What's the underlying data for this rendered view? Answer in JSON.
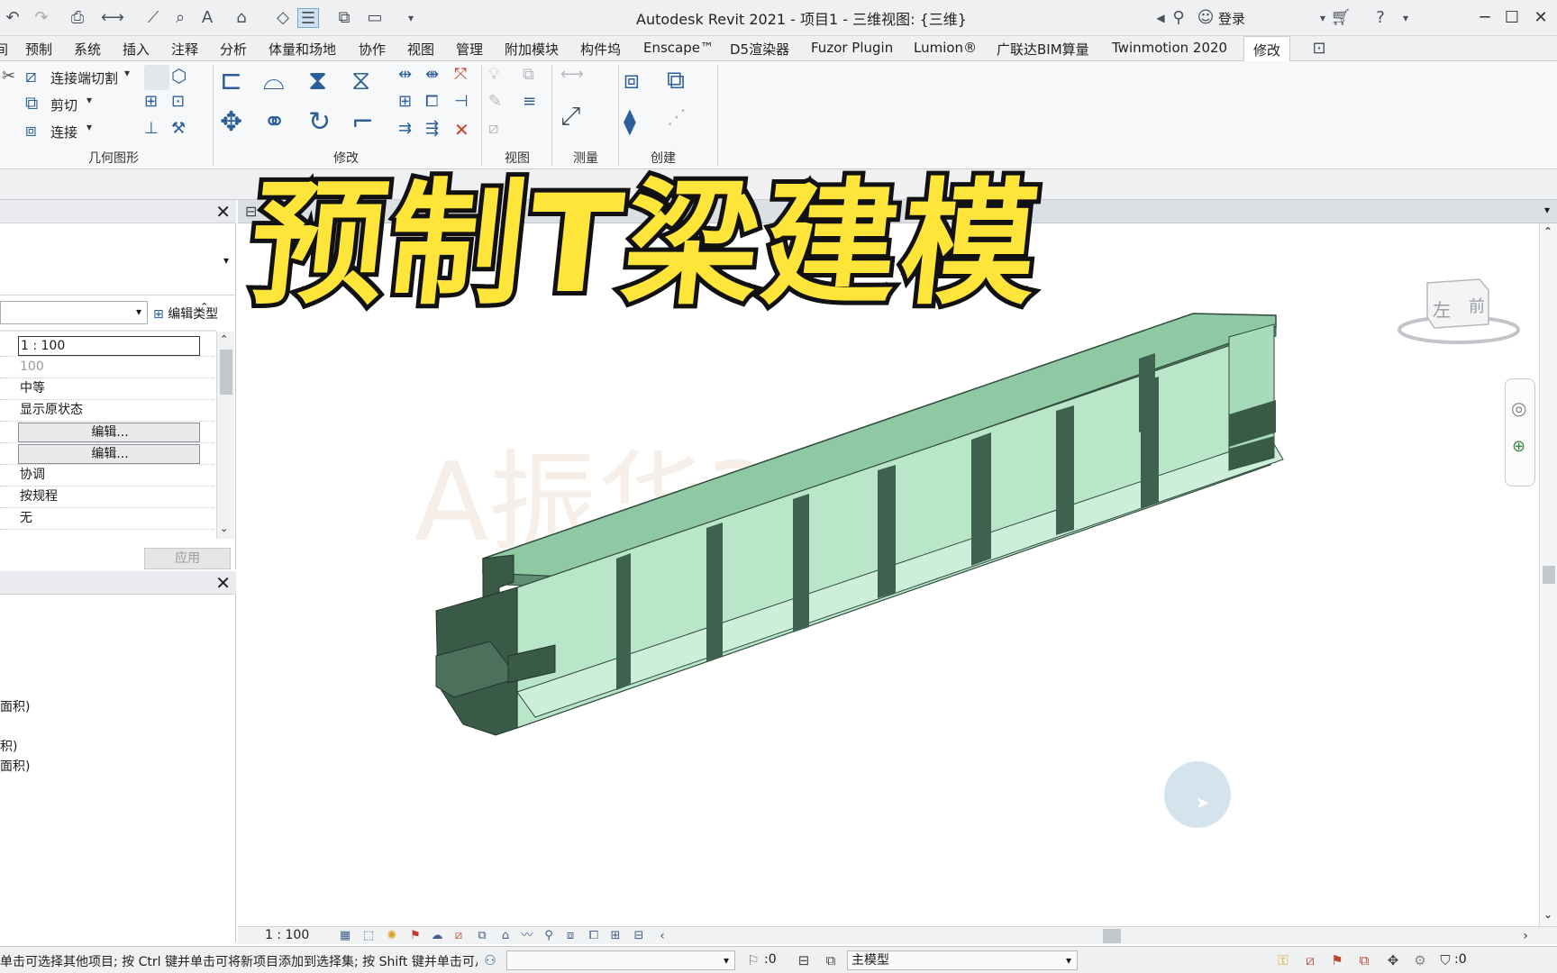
{
  "app_title": "Autodesk Revit 2021 - 项目1 - 三维视图: {三维}",
  "signin": "登录",
  "ribbon_tabs": [
    "预制",
    "系统",
    "插入",
    "注释",
    "分析",
    "体量和场地",
    "协作",
    "视图",
    "管理",
    "附加模块",
    "构件坞",
    "Enscape™",
    "D5渲染器",
    "Fuzor Plugin",
    "Lumion®",
    "广联达BIM算量",
    "Twinmotion 2020",
    "修改"
  ],
  "ribbon": {
    "join_cut": "连接端切割",
    "cut": "剪切",
    "join": "连接",
    "panel_geometry": "几何图形",
    "panel_modify": "修改",
    "panel_view": "视图",
    "panel_measure": "测量",
    "panel_create": "创建"
  },
  "properties": {
    "edit_type": "编辑类型",
    "rows": [
      "1 : 100",
      "100",
      "中等",
      "显示原状态",
      "编辑...",
      "编辑...",
      "协调",
      "按规程",
      "无"
    ],
    "apply": "应用"
  },
  "browser": {
    "items": [
      "面积)",
      "积)",
      "面积)"
    ]
  },
  "overlay_title": "预制T梁建模",
  "watermark": "A振华365",
  "view_cube": {
    "face_left": "左",
    "face_front": "前"
  },
  "view_control": {
    "scale": "1 : 100"
  },
  "status": {
    "message": "单击可选择其他项目; 按 Ctrl 键并单击可将新项目添加到选择集; 按 Shift 键并单击可从选择集中删除项目",
    "count": ":0",
    "model": "主模型",
    "filter_count": ":0"
  },
  "colors": {
    "beam_top": "#8ec9a4",
    "beam_side": "#b9e6c9",
    "beam_dark": "#3a5a48",
    "title_yellow": "#ffe53a"
  }
}
